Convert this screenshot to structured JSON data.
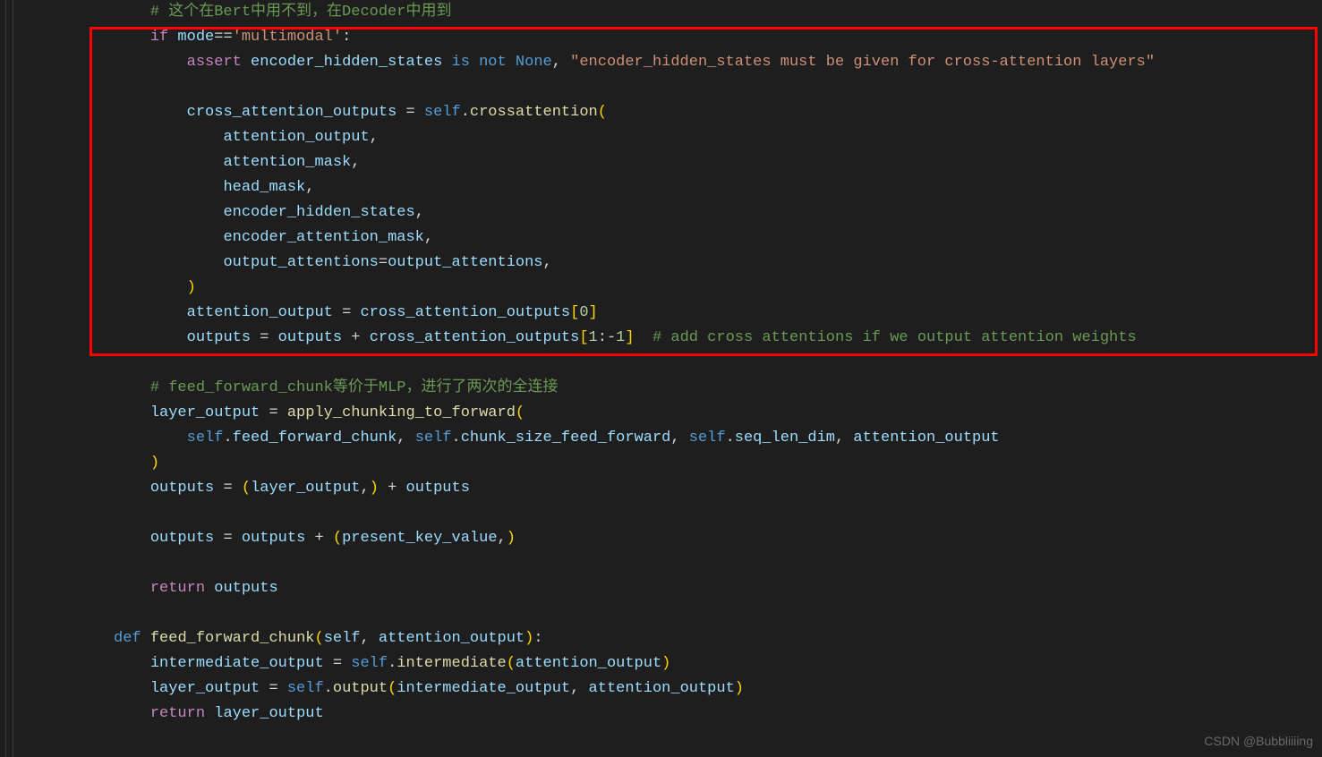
{
  "code": {
    "lines": [
      {
        "indent": "        ",
        "tokens": [
          {
            "t": "# 这个在Bert中用不到，在Decoder中用到",
            "c": "comment"
          }
        ]
      },
      {
        "indent": "        ",
        "tokens": [
          {
            "t": "if",
            "c": "keyword"
          },
          {
            "t": " mode",
            "c": "variable"
          },
          {
            "t": "==",
            "c": "operator"
          },
          {
            "t": "'multimodal'",
            "c": "string"
          },
          {
            "t": ":",
            "c": "white"
          }
        ]
      },
      {
        "indent": "            ",
        "tokens": [
          {
            "t": "assert",
            "c": "keyword"
          },
          {
            "t": " encoder_hidden_states ",
            "c": "variable"
          },
          {
            "t": "is",
            "c": "keyword2"
          },
          {
            "t": " ",
            "c": "white"
          },
          {
            "t": "not",
            "c": "keyword2"
          },
          {
            "t": " ",
            "c": "white"
          },
          {
            "t": "None",
            "c": "none"
          },
          {
            "t": ", ",
            "c": "white"
          },
          {
            "t": "\"encoder_hidden_states must be given for cross-attention layers\"",
            "c": "string"
          }
        ]
      },
      {
        "indent": "",
        "tokens": []
      },
      {
        "indent": "            ",
        "tokens": [
          {
            "t": "cross_attention_outputs ",
            "c": "variable"
          },
          {
            "t": "=",
            "c": "operator"
          },
          {
            "t": " ",
            "c": "white"
          },
          {
            "t": "self",
            "c": "self"
          },
          {
            "t": ".",
            "c": "white"
          },
          {
            "t": "crossattention",
            "c": "function"
          },
          {
            "t": "(",
            "c": "paren"
          }
        ]
      },
      {
        "indent": "                ",
        "tokens": [
          {
            "t": "attention_output",
            "c": "variable"
          },
          {
            "t": ",",
            "c": "white"
          }
        ]
      },
      {
        "indent": "                ",
        "tokens": [
          {
            "t": "attention_mask",
            "c": "variable"
          },
          {
            "t": ",",
            "c": "white"
          }
        ]
      },
      {
        "indent": "                ",
        "tokens": [
          {
            "t": "head_mask",
            "c": "variable"
          },
          {
            "t": ",",
            "c": "white"
          }
        ]
      },
      {
        "indent": "                ",
        "tokens": [
          {
            "t": "encoder_hidden_states",
            "c": "variable"
          },
          {
            "t": ",",
            "c": "white"
          }
        ]
      },
      {
        "indent": "                ",
        "tokens": [
          {
            "t": "encoder_attention_mask",
            "c": "variable"
          },
          {
            "t": ",",
            "c": "white"
          }
        ]
      },
      {
        "indent": "                ",
        "tokens": [
          {
            "t": "output_attentions",
            "c": "param"
          },
          {
            "t": "=",
            "c": "operator"
          },
          {
            "t": "output_attentions",
            "c": "variable"
          },
          {
            "t": ",",
            "c": "white"
          }
        ]
      },
      {
        "indent": "            ",
        "tokens": [
          {
            "t": ")",
            "c": "paren"
          }
        ]
      },
      {
        "indent": "            ",
        "tokens": [
          {
            "t": "attention_output ",
            "c": "variable"
          },
          {
            "t": "=",
            "c": "operator"
          },
          {
            "t": " cross_attention_outputs",
            "c": "variable"
          },
          {
            "t": "[",
            "c": "paren"
          },
          {
            "t": "0",
            "c": "number"
          },
          {
            "t": "]",
            "c": "paren"
          }
        ]
      },
      {
        "indent": "            ",
        "tokens": [
          {
            "t": "outputs ",
            "c": "variable"
          },
          {
            "t": "=",
            "c": "operator"
          },
          {
            "t": " outputs ",
            "c": "variable"
          },
          {
            "t": "+",
            "c": "operator"
          },
          {
            "t": " cross_attention_outputs",
            "c": "variable"
          },
          {
            "t": "[",
            "c": "paren"
          },
          {
            "t": "1",
            "c": "number"
          },
          {
            "t": ":",
            "c": "white"
          },
          {
            "t": "-",
            "c": "operator"
          },
          {
            "t": "1",
            "c": "number"
          },
          {
            "t": "]",
            "c": "paren"
          },
          {
            "t": "  ",
            "c": "white"
          },
          {
            "t": "# add cross attentions if we output attention weights",
            "c": "comment"
          }
        ]
      },
      {
        "indent": "",
        "tokens": []
      },
      {
        "indent": "        ",
        "tokens": [
          {
            "t": "# feed_forward_chunk等价于MLP，进行了两次的全连接",
            "c": "comment"
          }
        ]
      },
      {
        "indent": "        ",
        "tokens": [
          {
            "t": "layer_output ",
            "c": "variable"
          },
          {
            "t": "=",
            "c": "operator"
          },
          {
            "t": " ",
            "c": "white"
          },
          {
            "t": "apply_chunking_to_forward",
            "c": "function"
          },
          {
            "t": "(",
            "c": "paren"
          }
        ]
      },
      {
        "indent": "            ",
        "tokens": [
          {
            "t": "self",
            "c": "self"
          },
          {
            "t": ".",
            "c": "white"
          },
          {
            "t": "feed_forward_chunk",
            "c": "variable"
          },
          {
            "t": ", ",
            "c": "white"
          },
          {
            "t": "self",
            "c": "self"
          },
          {
            "t": ".",
            "c": "white"
          },
          {
            "t": "chunk_size_feed_forward",
            "c": "variable"
          },
          {
            "t": ", ",
            "c": "white"
          },
          {
            "t": "self",
            "c": "self"
          },
          {
            "t": ".",
            "c": "white"
          },
          {
            "t": "seq_len_dim",
            "c": "variable"
          },
          {
            "t": ", ",
            "c": "white"
          },
          {
            "t": "attention_output",
            "c": "variable"
          }
        ]
      },
      {
        "indent": "        ",
        "tokens": [
          {
            "t": ")",
            "c": "paren"
          }
        ]
      },
      {
        "indent": "        ",
        "tokens": [
          {
            "t": "outputs ",
            "c": "variable"
          },
          {
            "t": "=",
            "c": "operator"
          },
          {
            "t": " ",
            "c": "white"
          },
          {
            "t": "(",
            "c": "paren"
          },
          {
            "t": "layer_output",
            "c": "variable"
          },
          {
            "t": ",",
            "c": "white"
          },
          {
            "t": ")",
            "c": "paren"
          },
          {
            "t": " ",
            "c": "white"
          },
          {
            "t": "+",
            "c": "operator"
          },
          {
            "t": " outputs",
            "c": "variable"
          }
        ]
      },
      {
        "indent": "",
        "tokens": []
      },
      {
        "indent": "        ",
        "tokens": [
          {
            "t": "outputs ",
            "c": "variable"
          },
          {
            "t": "=",
            "c": "operator"
          },
          {
            "t": " outputs ",
            "c": "variable"
          },
          {
            "t": "+",
            "c": "operator"
          },
          {
            "t": " ",
            "c": "white"
          },
          {
            "t": "(",
            "c": "paren"
          },
          {
            "t": "present_key_value",
            "c": "variable"
          },
          {
            "t": ",",
            "c": "white"
          },
          {
            "t": ")",
            "c": "paren"
          }
        ]
      },
      {
        "indent": "",
        "tokens": []
      },
      {
        "indent": "        ",
        "tokens": [
          {
            "t": "return",
            "c": "keyword"
          },
          {
            "t": " outputs",
            "c": "variable"
          }
        ]
      },
      {
        "indent": "",
        "tokens": []
      },
      {
        "indent": "    ",
        "tokens": [
          {
            "t": "def",
            "c": "keyword2"
          },
          {
            "t": " ",
            "c": "white"
          },
          {
            "t": "feed_forward_chunk",
            "c": "function"
          },
          {
            "t": "(",
            "c": "paren"
          },
          {
            "t": "self",
            "c": "param"
          },
          {
            "t": ", ",
            "c": "white"
          },
          {
            "t": "attention_output",
            "c": "param"
          },
          {
            "t": ")",
            "c": "paren"
          },
          {
            "t": ":",
            "c": "white"
          }
        ]
      },
      {
        "indent": "        ",
        "tokens": [
          {
            "t": "intermediate_output ",
            "c": "variable"
          },
          {
            "t": "=",
            "c": "operator"
          },
          {
            "t": " ",
            "c": "white"
          },
          {
            "t": "self",
            "c": "self"
          },
          {
            "t": ".",
            "c": "white"
          },
          {
            "t": "intermediate",
            "c": "function"
          },
          {
            "t": "(",
            "c": "paren"
          },
          {
            "t": "attention_output",
            "c": "variable"
          },
          {
            "t": ")",
            "c": "paren"
          }
        ]
      },
      {
        "indent": "        ",
        "tokens": [
          {
            "t": "layer_output ",
            "c": "variable"
          },
          {
            "t": "=",
            "c": "operator"
          },
          {
            "t": " ",
            "c": "white"
          },
          {
            "t": "self",
            "c": "self"
          },
          {
            "t": ".",
            "c": "white"
          },
          {
            "t": "output",
            "c": "function"
          },
          {
            "t": "(",
            "c": "paren"
          },
          {
            "t": "intermediate_output",
            "c": "variable"
          },
          {
            "t": ", ",
            "c": "white"
          },
          {
            "t": "attention_output",
            "c": "variable"
          },
          {
            "t": ")",
            "c": "paren"
          }
        ]
      },
      {
        "indent": "        ",
        "tokens": [
          {
            "t": "return",
            "c": "keyword"
          },
          {
            "t": " layer_output",
            "c": "variable"
          }
        ]
      }
    ]
  },
  "watermark": "CSDN @Bubbliiiing"
}
